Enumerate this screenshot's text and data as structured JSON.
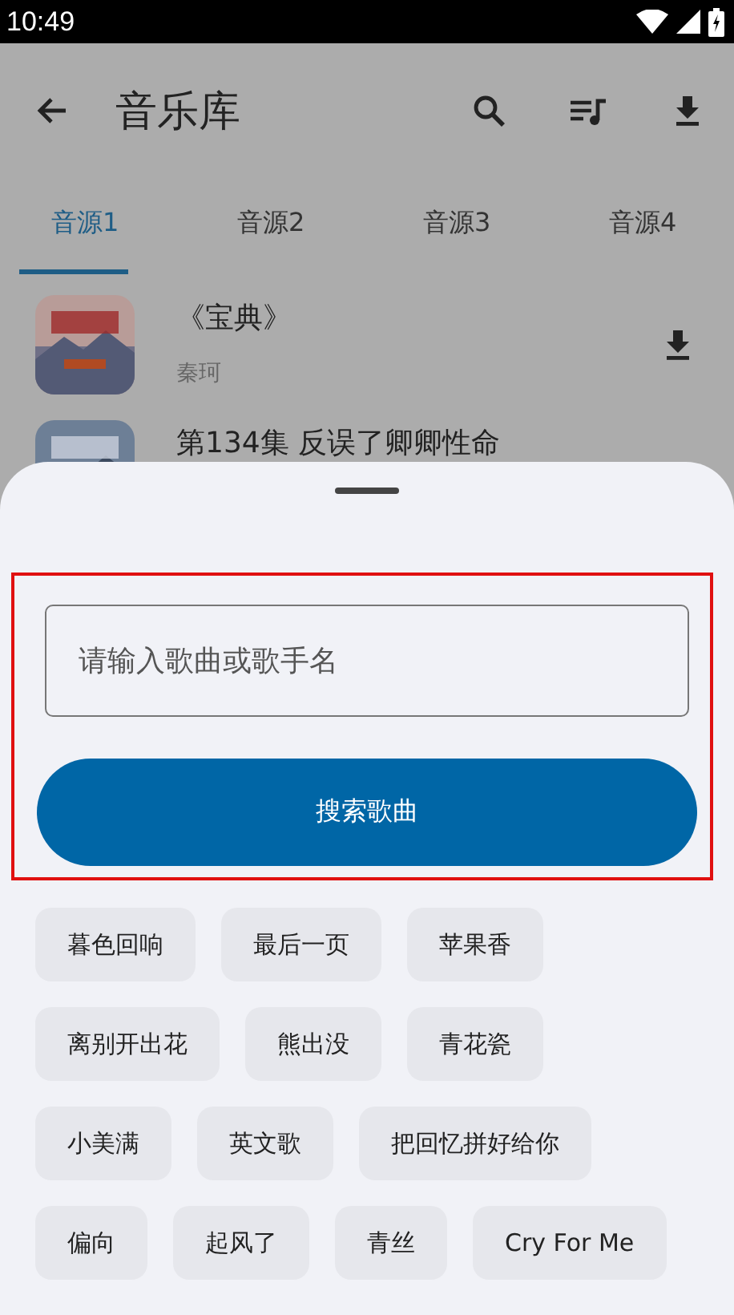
{
  "status_bar": {
    "time": "10:49"
  },
  "app_bar": {
    "title": "音乐库"
  },
  "tabs": [
    {
      "label": "音源1",
      "selected": true
    },
    {
      "label": "音源2",
      "selected": false
    },
    {
      "label": "音源3",
      "selected": false
    },
    {
      "label": "音源4",
      "selected": false
    }
  ],
  "songs": [
    {
      "title": "《宝典》",
      "artist": "秦珂",
      "kind": "picture"
    },
    {
      "title": "第134集 反误了卿卿性命",
      "kind": "picture"
    }
  ],
  "sheet": {
    "search": {
      "placeholder": "请输入歌曲或歌手名"
    },
    "button": "搜索歌曲",
    "highlighted": true,
    "chips": [
      "暮色回响",
      "最后一页",
      "苹果香",
      "离别开出花",
      "熊出没",
      "青花瓷",
      "小美满",
      "英文歌",
      "把回忆拼好给你",
      "偏向",
      "起风了",
      "青丝",
      "Cry For Me"
    ]
  }
}
